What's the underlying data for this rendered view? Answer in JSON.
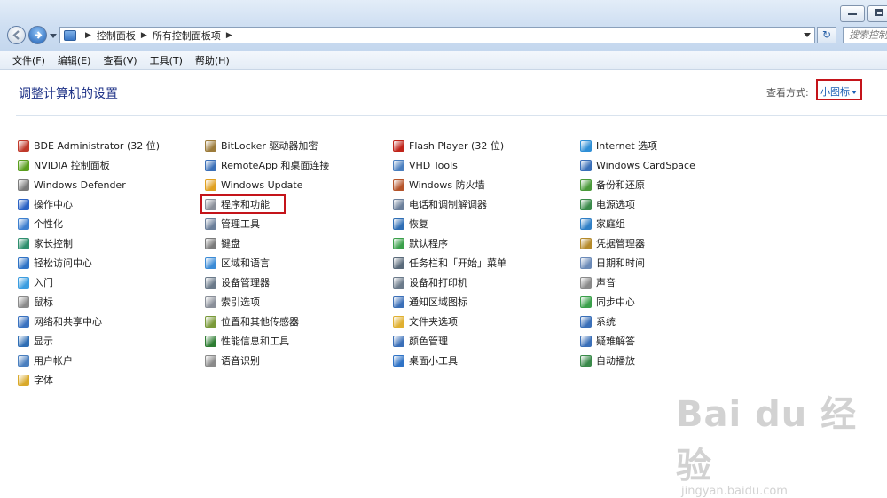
{
  "window": {
    "minimize_label": "",
    "restore_label": ""
  },
  "address": {
    "crumbs": [
      "控制面板",
      "所有控制面板项"
    ],
    "search_placeholder": "搜索控制面板"
  },
  "menu": [
    "文件(F)",
    "编辑(E)",
    "查看(V)",
    "工具(T)",
    "帮助(H)"
  ],
  "page": {
    "title": "调整计算机的设置",
    "view_label": "查看方式:",
    "view_value": "小图标"
  },
  "columns": [
    [
      {
        "label": "BDE Administrator (32 位)",
        "icon": "bde-icon",
        "color": "#c0392b"
      },
      {
        "label": "NVIDIA 控制面板",
        "icon": "nvidia-icon",
        "color": "#5a9e1e"
      },
      {
        "label": "Windows Defender",
        "icon": "defender-icon",
        "color": "#7a7a7a"
      },
      {
        "label": "操作中心",
        "icon": "flag-icon",
        "color": "#2b62c4"
      },
      {
        "label": "个性化",
        "icon": "monitor-icon",
        "color": "#3d7fcf"
      },
      {
        "label": "家长控制",
        "icon": "people-icon",
        "color": "#2f8f6e"
      },
      {
        "label": "轻松访问中心",
        "icon": "accessibility-icon",
        "color": "#2f73c6"
      },
      {
        "label": "入门",
        "icon": "start-icon",
        "color": "#3b9de0"
      },
      {
        "label": "鼠标",
        "icon": "mouse-icon",
        "color": "#8a8a8a"
      },
      {
        "label": "网络和共享中心",
        "icon": "network-icon",
        "color": "#3a72c0"
      },
      {
        "label": "显示",
        "icon": "display-icon",
        "color": "#2f6eb5"
      },
      {
        "label": "用户帐户",
        "icon": "users-icon",
        "color": "#4a7fbf"
      },
      {
        "label": "字体",
        "icon": "fonts-icon",
        "color": "#d9a92a"
      }
    ],
    [
      {
        "label": "BitLocker 驱动器加密",
        "icon": "bitlocker-icon",
        "color": "#9c7b3a"
      },
      {
        "label": "RemoteApp 和桌面连接",
        "icon": "remoteapp-icon",
        "color": "#3a6fb8"
      },
      {
        "label": "Windows Update",
        "icon": "update-icon",
        "color": "#e0a020"
      },
      {
        "label": "程序和功能",
        "icon": "programs-icon",
        "color": "#8a8f99",
        "highlighted": true
      },
      {
        "label": "管理工具",
        "icon": "admin-tools-icon",
        "color": "#6b7f9a"
      },
      {
        "label": "键盘",
        "icon": "keyboard-icon",
        "color": "#7a7a7a"
      },
      {
        "label": "区域和语言",
        "icon": "globe-icon",
        "color": "#3b8bd6"
      },
      {
        "label": "设备管理器",
        "icon": "device-manager-icon",
        "color": "#6b7a8a"
      },
      {
        "label": "索引选项",
        "icon": "index-icon",
        "color": "#8a8f99"
      },
      {
        "label": "位置和其他传感器",
        "icon": "sensor-icon",
        "color": "#7a9a3a"
      },
      {
        "label": "性能信息和工具",
        "icon": "performance-icon",
        "color": "#2e7d32"
      },
      {
        "label": "语音识别",
        "icon": "microphone-icon",
        "color": "#8a8a8a"
      }
    ],
    [
      {
        "label": "Flash Player (32 位)",
        "icon": "flash-icon",
        "color": "#c0241a"
      },
      {
        "label": "VHD Tools",
        "icon": "vhd-icon",
        "color": "#4a7fbf"
      },
      {
        "label": "Windows 防火墙",
        "icon": "firewall-icon",
        "color": "#b5542a"
      },
      {
        "label": "电话和调制解调器",
        "icon": "phone-icon",
        "color": "#6b7f9a"
      },
      {
        "label": "恢复",
        "icon": "recovery-icon",
        "color": "#2f6eb5"
      },
      {
        "label": "默认程序",
        "icon": "default-programs-icon",
        "color": "#3aa04a"
      },
      {
        "label": "任务栏和「开始」菜单",
        "icon": "taskbar-icon",
        "color": "#5a6a7a"
      },
      {
        "label": "设备和打印机",
        "icon": "printer-icon",
        "color": "#6b7a8a"
      },
      {
        "label": "通知区域图标",
        "icon": "notification-icon",
        "color": "#3b6fb8"
      },
      {
        "label": "文件夹选项",
        "icon": "folder-icon",
        "color": "#e0b030"
      },
      {
        "label": "颜色管理",
        "icon": "color-management-icon",
        "color": "#3a6fb8"
      },
      {
        "label": "桌面小工具",
        "icon": "gadgets-icon",
        "color": "#2f73c6"
      }
    ],
    [
      {
        "label": "Internet 选项",
        "icon": "internet-icon",
        "color": "#2f8fd6"
      },
      {
        "label": "Windows CardSpace",
        "icon": "cardspace-icon",
        "color": "#3a6fb8"
      },
      {
        "label": "备份和还原",
        "icon": "backup-icon",
        "color": "#4a9a3a"
      },
      {
        "label": "电源选项",
        "icon": "power-icon",
        "color": "#3a8a4a"
      },
      {
        "label": "家庭组",
        "icon": "homegroup-icon",
        "color": "#2f7fc6"
      },
      {
        "label": "凭据管理器",
        "icon": "credential-icon",
        "color": "#b58a2a"
      },
      {
        "label": "日期和时间",
        "icon": "clock-icon",
        "color": "#6b8ab8"
      },
      {
        "label": "声音",
        "icon": "sound-icon",
        "color": "#8a8a8a"
      },
      {
        "label": "同步中心",
        "icon": "sync-icon",
        "color": "#3aa04a"
      },
      {
        "label": "系统",
        "icon": "system-icon",
        "color": "#3a6fb8"
      },
      {
        "label": "疑难解答",
        "icon": "troubleshoot-icon",
        "color": "#3a6fb8"
      },
      {
        "label": "自动播放",
        "icon": "autoplay-icon",
        "color": "#3a8a4a"
      }
    ]
  ],
  "watermark": {
    "main": "Bai du 经验",
    "sub": "jingyan.baidu.com"
  }
}
